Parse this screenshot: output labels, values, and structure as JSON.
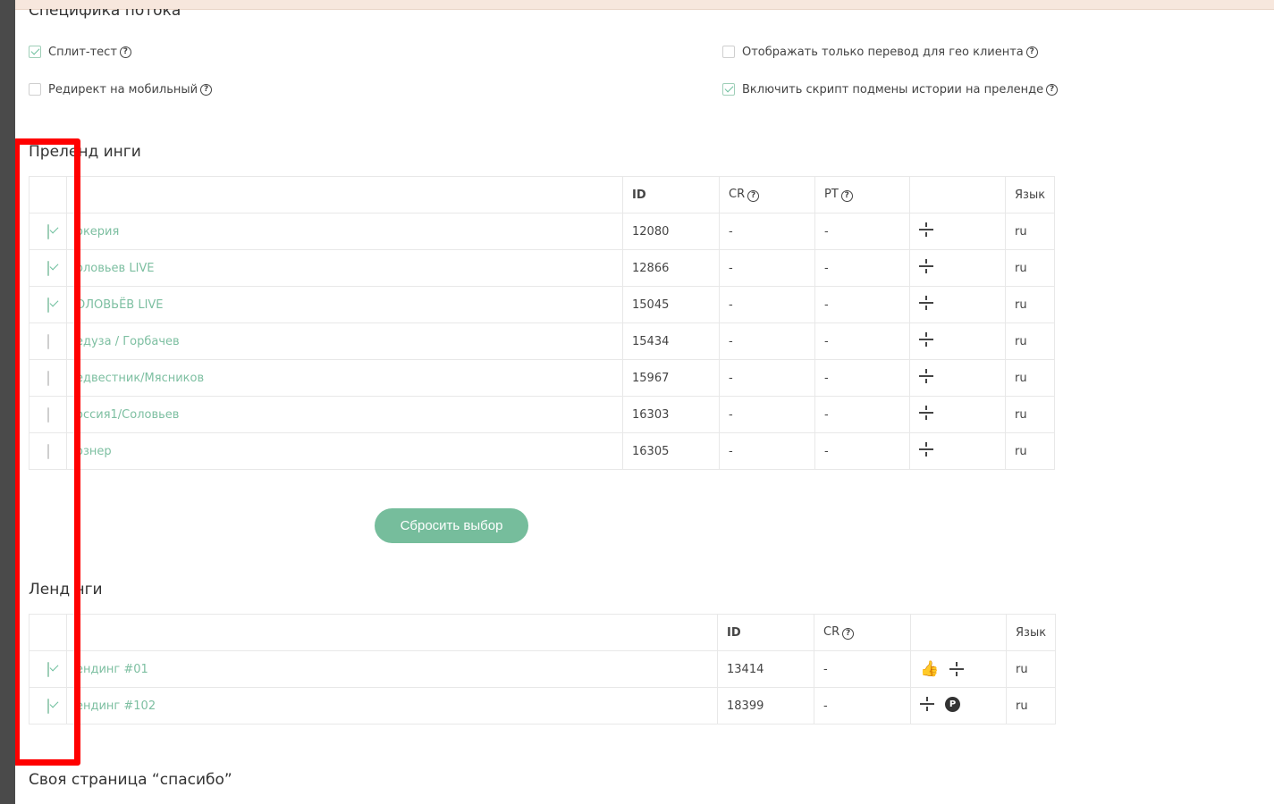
{
  "flow_spec": {
    "title": "Специфика потока",
    "options": [
      {
        "label": "Сплит-тест",
        "checked": true
      },
      {
        "label": "Редирект на мобильный",
        "checked": false
      },
      {
        "label": "Отображать только перевод для гео клиента",
        "checked": false
      },
      {
        "label": "Включить скрипт подмены истории на преленде",
        "checked": true
      }
    ]
  },
  "prelandings": {
    "title": "Преленд  инги",
    "headers": {
      "id": "ID",
      "cr": "CR",
      "pt": "PT",
      "lang": "Язык"
    },
    "rows": [
      {
        "name": "окерия",
        "id": "12080",
        "cr": "-",
        "pt": "-",
        "lang": "ru",
        "checked": true
      },
      {
        "name": "оловьев LIVE",
        "id": "12866",
        "cr": "-",
        "pt": "-",
        "lang": "ru",
        "checked": true
      },
      {
        "name": "ОЛОВЬЁВ LIVE",
        "id": "15045",
        "cr": "-",
        "pt": "-",
        "lang": "ru",
        "checked": true
      },
      {
        "name": "едуза / Горбачев",
        "id": "15434",
        "cr": "-",
        "pt": "-",
        "lang": "ru",
        "checked": false
      },
      {
        "name": "едвестник/Мясников",
        "id": "15967",
        "cr": "-",
        "pt": "-",
        "lang": "ru",
        "checked": false
      },
      {
        "name": "оссия1/Соловьев",
        "id": "16303",
        "cr": "-",
        "pt": "-",
        "lang": "ru",
        "checked": false
      },
      {
        "name": "ознер",
        "id": "16305",
        "cr": "-",
        "pt": "-",
        "lang": "ru",
        "checked": false
      }
    ],
    "reset_label": "Сбросить выбор"
  },
  "landings": {
    "title": "Ленд  нги",
    "headers": {
      "id": "ID",
      "cr": "CR",
      "lang": "Язык"
    },
    "rows": [
      {
        "name": "ендинг #01",
        "id": "13414",
        "cr": "-",
        "lang": "ru",
        "checked": true,
        "icons": [
          "thumbs-up-icon",
          "expand-icon"
        ]
      },
      {
        "name": "ендинг #102",
        "id": "18399",
        "cr": "-",
        "lang": "ru",
        "checked": true,
        "icons": [
          "expand-icon",
          "p-badge-icon"
        ]
      }
    ]
  },
  "thanks_page": {
    "title": "Своя страница “спасибо”"
  },
  "colors": {
    "accent": "#76bd9c",
    "link": "#7dbfa1",
    "highlight": "#ff0000"
  }
}
